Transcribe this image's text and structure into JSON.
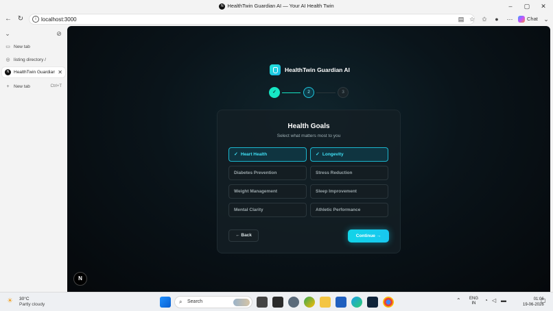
{
  "window": {
    "title": "HealthTwin Guardian AI — Your AI Health Twin",
    "controls": {
      "minimize": "–",
      "maximize": "▢",
      "close": "✕"
    }
  },
  "browser": {
    "url": "localhost:3000",
    "chat_label": "Chat"
  },
  "sidebar": {
    "items": [
      {
        "label": "New tab",
        "icon": "page-icon"
      },
      {
        "label": "listing directory /",
        "icon": "globe-icon"
      },
      {
        "label": "HealthTwin Guardian AI",
        "icon": "next-logo-icon",
        "active": true
      },
      {
        "label": "New tab",
        "icon": "plus-icon",
        "shortcut": "Ctrl+T"
      }
    ]
  },
  "app": {
    "brand_name": "HealthTwin Guardian AI",
    "steps": [
      {
        "label": "✓",
        "state": "done"
      },
      {
        "label": "2",
        "state": "current"
      },
      {
        "label": "3",
        "state": "upcoming"
      }
    ],
    "heading": "Health Goals",
    "subheading": "Select what matters most to you",
    "goals": [
      {
        "label": "Heart Health",
        "selected": true
      },
      {
        "label": "Longevity",
        "selected": true
      },
      {
        "label": "Diabetes Prevention",
        "selected": false
      },
      {
        "label": "Stress Reduction",
        "selected": false
      },
      {
        "label": "Weight Management",
        "selected": false
      },
      {
        "label": "Sleep Improvement",
        "selected": false
      },
      {
        "label": "Mental Clarity",
        "selected": false
      },
      {
        "label": "Athletic Performance",
        "selected": false
      }
    ],
    "back_label": "Back",
    "continue_label": "Continue",
    "dev_badge": "N",
    "accent_color": "#16e6c4"
  },
  "taskbar": {
    "weather_temp": "30°C",
    "weather_condition": "Partly cloudy",
    "search_label": "Search",
    "lang_line1": "ENG",
    "lang_line2": "IN",
    "time": "01:06",
    "date": "19-06-2026"
  }
}
